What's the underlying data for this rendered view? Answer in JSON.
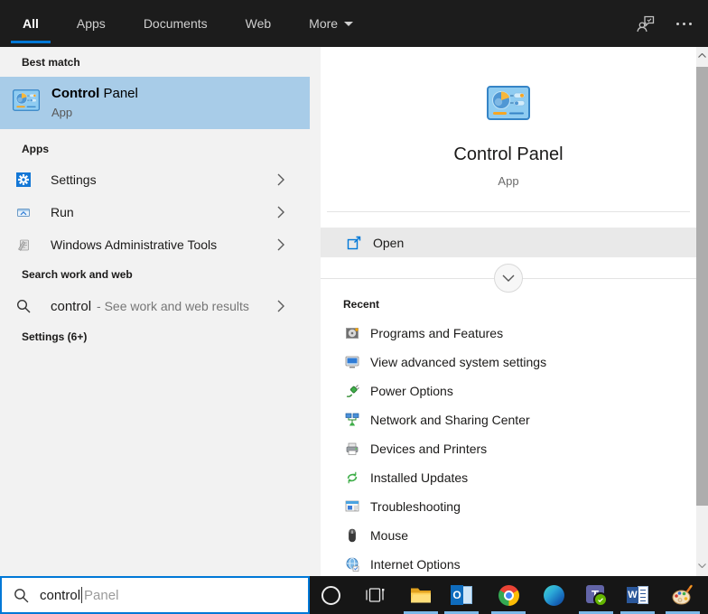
{
  "topbar": {
    "tabs": [
      {
        "label": "All",
        "active": true
      },
      {
        "label": "Apps",
        "active": false
      },
      {
        "label": "Documents",
        "active": false
      },
      {
        "label": "Web",
        "active": false
      },
      {
        "label": "More",
        "active": false,
        "has_dropdown": true
      }
    ],
    "icons": [
      "feedback-icon",
      "more-options-icon"
    ]
  },
  "left_panel": {
    "best_match": {
      "header": "Best match",
      "title_query": "Control",
      "title_rest": " Panel",
      "subtitle": "App",
      "icon": "control-panel-icon"
    },
    "apps": {
      "header": "Apps",
      "items": [
        {
          "label": "Settings",
          "icon": "settings-gear-icon"
        },
        {
          "label": "Run",
          "icon": "run-window-icon"
        },
        {
          "label": "Windows Administrative Tools",
          "icon": "admin-tools-icon"
        }
      ]
    },
    "search_web": {
      "header": "Search work and web",
      "query": "control",
      "suffix": "- See work and web results",
      "icon": "search-icon"
    },
    "settings_group": {
      "header": "Settings (6+)"
    }
  },
  "preview_panel": {
    "title": "Control Panel",
    "subtitle": "App",
    "app_icon": "control-panel-icon",
    "actions": [
      {
        "label": "Open",
        "icon": "open-external-icon"
      }
    ],
    "recent": {
      "header": "Recent",
      "items": [
        {
          "label": "Programs and Features",
          "icon": "programs-features-icon"
        },
        {
          "label": "View advanced system settings",
          "icon": "system-properties-icon"
        },
        {
          "label": "Power Options",
          "icon": "power-options-icon"
        },
        {
          "label": "Network and Sharing Center",
          "icon": "network-sharing-icon"
        },
        {
          "label": "Devices and Printers",
          "icon": "devices-printers-icon"
        },
        {
          "label": "Installed Updates",
          "icon": "installed-updates-icon"
        },
        {
          "label": "Troubleshooting",
          "icon": "troubleshooting-icon"
        },
        {
          "label": "Mouse",
          "icon": "mouse-icon"
        },
        {
          "label": "Internet Options",
          "icon": "internet-options-icon"
        }
      ]
    }
  },
  "taskbar": {
    "search": {
      "value": "control",
      "suggestion": "Panel"
    },
    "logos": {
      "outlook": "O",
      "teams": "T",
      "word": "W"
    },
    "icons": [
      "cortana-icon",
      "task-view-icon",
      "file-explorer-icon",
      "outlook-icon",
      "chrome-icon",
      "edge-icon",
      "teams-icon",
      "word-icon",
      "paint-icon"
    ]
  },
  "colors": {
    "accent": "#0078d7",
    "best_match_highlight": "#a8cce8",
    "open_row": "#e9e9e9",
    "topbar_bg": "#1c1c1c",
    "left_bg": "#f2f2f2",
    "taskbar_bg": "#161616",
    "indicator_blue": "#7cb8e8"
  }
}
